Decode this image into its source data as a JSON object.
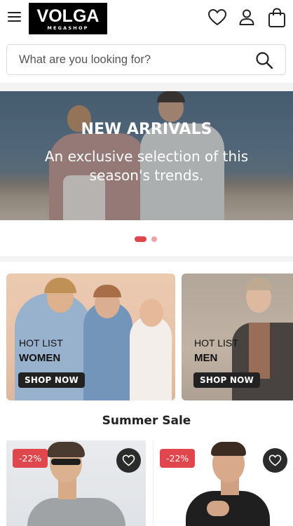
{
  "header": {
    "logo_main": "VOLGA",
    "logo_sub": "MEGASHOP",
    "icons": [
      "menu-icon",
      "heart-icon",
      "user-icon",
      "shopping-bag-icon"
    ]
  },
  "search": {
    "placeholder": "What are you looking for?",
    "icon": "search-icon"
  },
  "hero": {
    "title": "NEW ARRIVALS",
    "subtitle": "An exclusive selection of this season's trends.",
    "slide_count": 2,
    "active_slide": 1
  },
  "categories": [
    {
      "tag": "HOT LIST",
      "title": "WOMEN",
      "button": "SHOP NOW"
    },
    {
      "tag": "HOT LIST",
      "title": "MEN",
      "button": "SHOP NOW"
    }
  ],
  "section": {
    "title": "Summer Sale"
  },
  "products": [
    {
      "discount": "-22%"
    },
    {
      "discount": "-22%"
    }
  ],
  "colors": {
    "accent": "#e0474c",
    "dark": "#222222",
    "dot_inactive": "#f0a3a6"
  }
}
